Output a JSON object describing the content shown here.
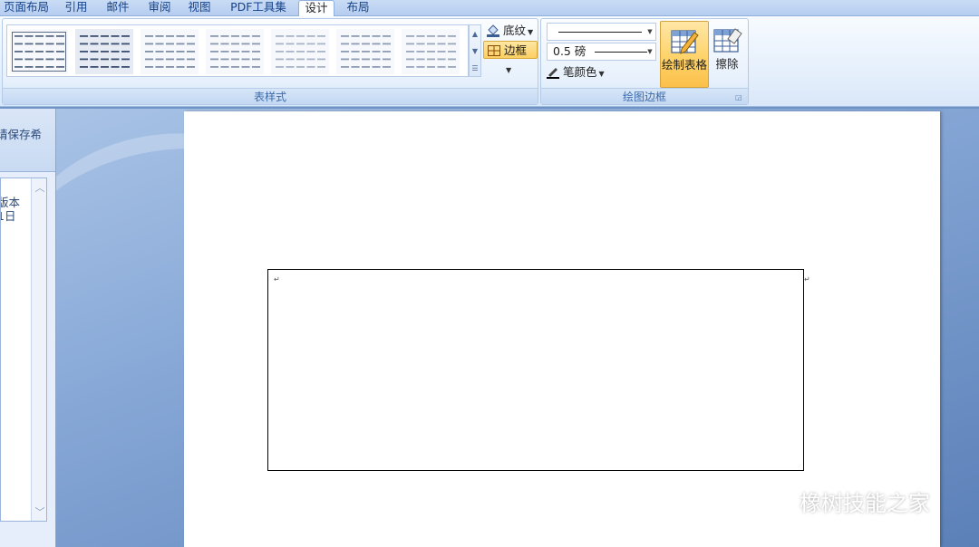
{
  "tabs": [
    {
      "label": "页面布局",
      "active": false
    },
    {
      "label": "引用",
      "active": false
    },
    {
      "label": "邮件",
      "active": false
    },
    {
      "label": "审阅",
      "active": false
    },
    {
      "label": "视图",
      "active": false
    },
    {
      "label": "PDF工具集",
      "active": false
    },
    {
      "label": "设计",
      "active": true
    },
    {
      "label": "布局",
      "active": false
    }
  ],
  "table_styles": {
    "group_label": "表样式",
    "shading_label": "底纹",
    "borders_label": "边框",
    "swatch_colors": [
      "#5a6b86",
      "#3c4f70",
      "#7f8fa8",
      "#8a98b0",
      "#a8b4c8",
      "#8e9cb5",
      "#9aa7bd"
    ]
  },
  "draw_borders": {
    "group_label": "绘图边框",
    "weight_value": "0.5 磅",
    "pen_color_label": "笔颜色",
    "draw_table_label": "绘制表格",
    "eraser_label": "擦除"
  },
  "left_pane": {
    "header_text": "请保存希",
    "list_line1": "版本",
    "list_line2": "1日"
  },
  "document": {
    "paragraph_mark": "↵",
    "cell_mark": "↵"
  },
  "watermark": {
    "text": "橡树技能之家"
  },
  "colors": {
    "accent_active": "#fbcf62",
    "ribbon_text": "#15428b"
  }
}
